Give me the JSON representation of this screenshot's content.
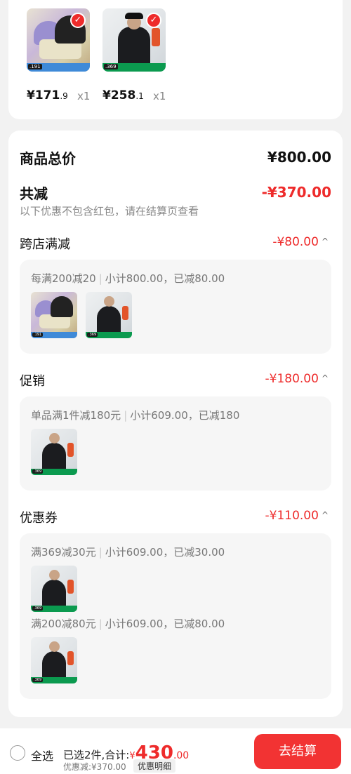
{
  "top_items": [
    {
      "name": "hat",
      "price_int": "¥171",
      "price_dec": ".9",
      "qty": "x1",
      "tag": ".191"
    },
    {
      "name": "jacket",
      "price_int": "¥258",
      "price_dec": ".1",
      "qty": "x1",
      "tag": ".369"
    }
  ],
  "summary": {
    "total_label": "商品总价",
    "total_value": "¥800.00",
    "reduce_label": "共减",
    "reduce_value": "-¥370.00",
    "note": "以下优惠不包含红包，请在结算页查看"
  },
  "sections": [
    {
      "label": "跨店满减",
      "value": "-¥80.00",
      "lines": [
        {
          "rule": "每满200减20",
          "detail": "小计800.00，已减80.00"
        }
      ]
    },
    {
      "label": "促销",
      "value": "-¥180.00",
      "lines": [
        {
          "rule": "单品满1件减180元",
          "detail": "小计609.00，已减180"
        }
      ]
    },
    {
      "label": "优惠券",
      "value": "-¥110.00",
      "lines": [
        {
          "rule": "满369减30元",
          "detail": "小计609.00，已减30.00"
        },
        {
          "rule": "满200减80元",
          "detail": "小计609.00，已减80.00"
        }
      ]
    }
  ],
  "bottom": {
    "select_all": "全选",
    "selected_text": "已选2件,合计:",
    "yen": "¥",
    "total_int": "430",
    "total_dec": ".00",
    "discount_text": "优惠减:¥370.00",
    "detail_button": "优惠明细",
    "checkout_button": "去结算"
  },
  "colors": {
    "accent": "#ee2b2b",
    "checkout": "#f23333"
  }
}
